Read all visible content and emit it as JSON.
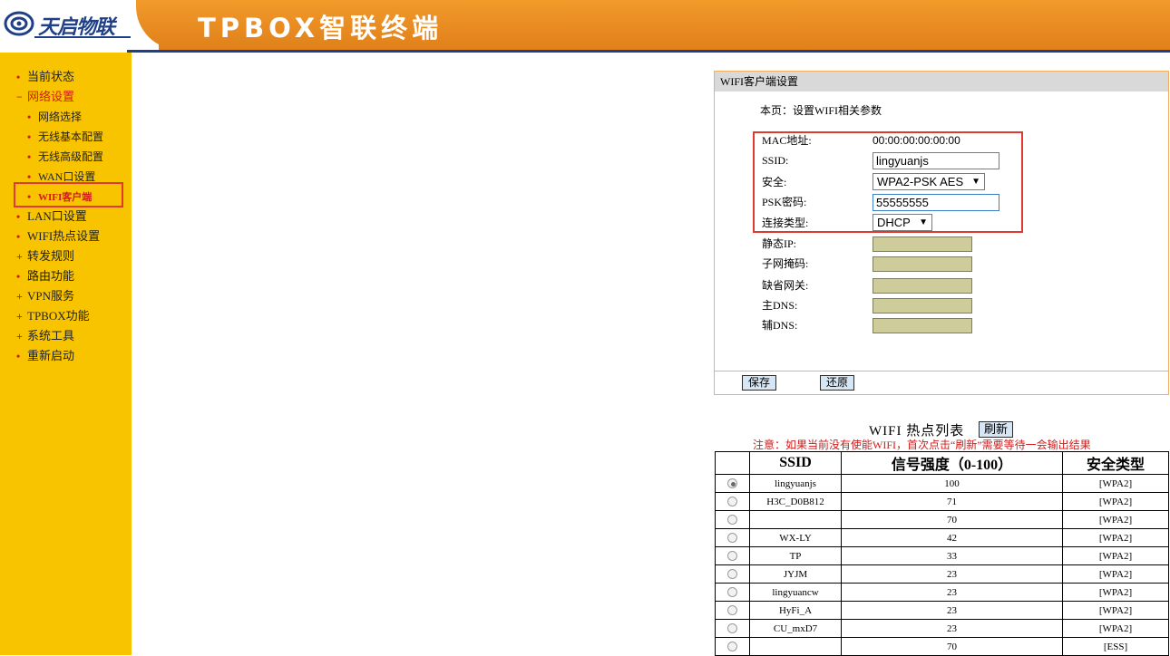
{
  "header": {
    "logo_text": "天启物联",
    "product_title": "TPBOX智联终端"
  },
  "sidebar": {
    "items": [
      {
        "label": "当前状态",
        "bullet": "•"
      },
      {
        "label": "网络设置",
        "bullet": "−"
      },
      {
        "label": "网络选择",
        "bullet": "•"
      },
      {
        "label": "无线基本配置",
        "bullet": "•"
      },
      {
        "label": "无线高级配置",
        "bullet": "•"
      },
      {
        "label": "WAN口设置",
        "bullet": "•"
      },
      {
        "label": "WIFI客户端",
        "bullet": "•"
      },
      {
        "label": "LAN口设置",
        "bullet": "•"
      },
      {
        "label": "WIFI热点设置",
        "bullet": "•"
      },
      {
        "label": "转发规则",
        "bullet": "+"
      },
      {
        "label": "路由功能",
        "bullet": "•"
      },
      {
        "label": "VPN服务",
        "bullet": "+"
      },
      {
        "label": "TPBOX功能",
        "bullet": "+"
      },
      {
        "label": "系统工具",
        "bullet": "+"
      },
      {
        "label": "重新启动",
        "bullet": "•"
      }
    ]
  },
  "panel": {
    "title": "WIFI客户端设置",
    "description": "本页：设置WIFI相关参数",
    "fields": {
      "mac_label": "MAC地址:",
      "mac_value": "00:00:00:00:00:00",
      "ssid_label": "SSID:",
      "ssid_value": "lingyuanjs",
      "security_label": "安全:",
      "security_value": "WPA2-PSK AES",
      "psk_label": "PSK密码:",
      "psk_value": "55555555",
      "conn_label": "连接类型:",
      "conn_value": "DHCP",
      "static_ip_label": "静态IP:",
      "subnet_label": "子网掩码:",
      "gateway_label": "缺省网关:",
      "dns1_label": "主DNS:",
      "dns2_label": "辅DNS:"
    },
    "save_label": "保存",
    "restore_label": "还原"
  },
  "hotspots": {
    "title": "WIFI 热点列表",
    "refresh_label": "刷新",
    "note": "注意：如果当前没有使能WIFI，首次点击“刷新”需要等待一会输出结果",
    "columns": [
      "",
      "SSID",
      "信号强度（0-100）",
      "安全类型"
    ],
    "rows": [
      {
        "ssid": "lingyuanjs",
        "signal": "100",
        "security": "[WPA2]",
        "selected": true
      },
      {
        "ssid": "H3C_D0B812",
        "signal": "71",
        "security": "[WPA2]",
        "selected": false
      },
      {
        "ssid": "",
        "signal": "70",
        "security": "[WPA2]",
        "selected": false
      },
      {
        "ssid": "WX-LY",
        "signal": "42",
        "security": "[WPA2]",
        "selected": false
      },
      {
        "ssid": "TP",
        "signal": "33",
        "security": "[WPA2]",
        "selected": false
      },
      {
        "ssid": "JYJM",
        "signal": "23",
        "security": "[WPA2]",
        "selected": false
      },
      {
        "ssid": "lingyuancw",
        "signal": "23",
        "security": "[WPA2]",
        "selected": false
      },
      {
        "ssid": "HyFi_A",
        "signal": "23",
        "security": "[WPA2]",
        "selected": false
      },
      {
        "ssid": "CU_mxD7",
        "signal": "23",
        "security": "[WPA2]",
        "selected": false
      },
      {
        "ssid": "",
        "signal": "70",
        "security": "[ESS]",
        "selected": false
      }
    ]
  },
  "colors": {
    "header_orange": "#e8881f",
    "header_navy": "#1f3f86",
    "sidebar_yellow": "#f8c400",
    "active_red": "#d21b1b",
    "highlight_box": "#e0392f"
  }
}
